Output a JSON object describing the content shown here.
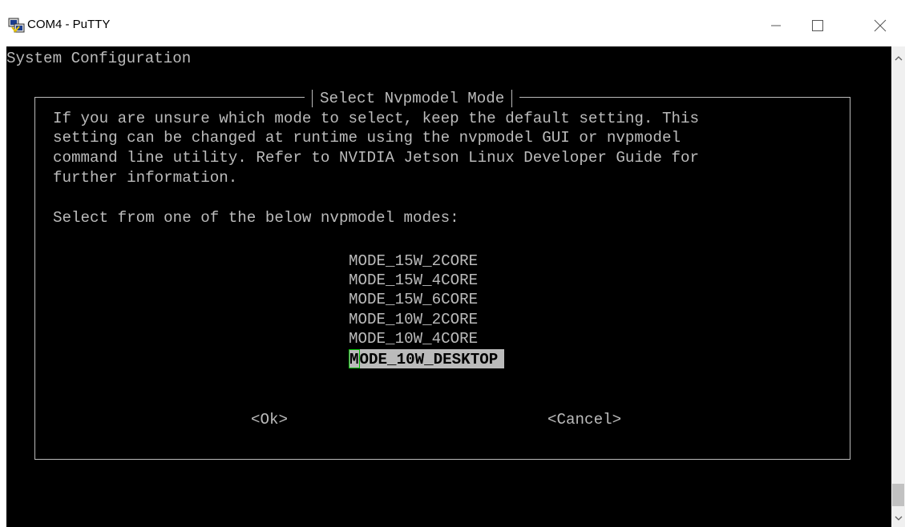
{
  "window": {
    "title": "COM4 - PuTTY",
    "icon": "putty-icon",
    "controls": {
      "minimize": "minimize-icon",
      "maximize": "maximize-icon",
      "close": "close-icon"
    }
  },
  "terminal": {
    "background": "#000000",
    "foreground": "#bbbbbb",
    "header": "System Configuration",
    "dialog": {
      "title": "Select Nvpmodel Mode",
      "description_lines": [
        "If you are unsure which mode to select, keep the default setting. This",
        "setting can be changed at runtime using the nvpmodel GUI or nvpmodel",
        "command line utility. Refer to NVIDIA Jetson Linux Developer Guide for",
        "further information."
      ],
      "prompt": "Select from one of the below nvpmodel modes:",
      "modes": [
        "MODE_15W_2CORE",
        "MODE_15W_4CORE",
        "MODE_15W_6CORE",
        "MODE_10W_2CORE",
        "MODE_10W_4CORE"
      ],
      "selected_mode_first": "M",
      "selected_mode_rest": "ODE_10W_DESKTOP",
      "ok_label": "<Ok>",
      "cancel_label": "<Cancel>"
    }
  },
  "scrollbar": {
    "up_icon": "chevron-up-icon",
    "down_icon": "chevron-down-icon",
    "position": 1.0
  }
}
